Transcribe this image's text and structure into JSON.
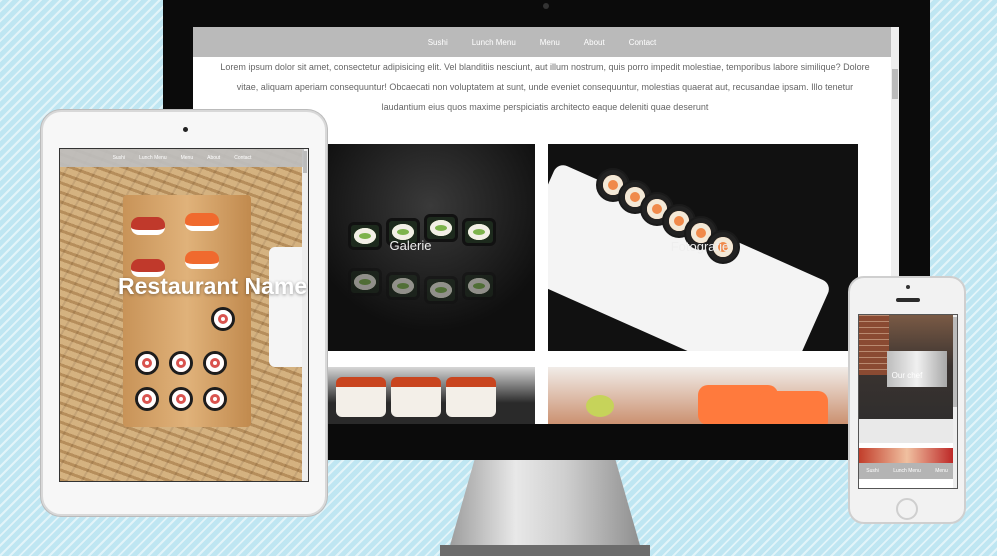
{
  "desktop": {
    "nav": [
      "Sushi",
      "Lunch Menu",
      "Menu",
      "About",
      "Contact"
    ],
    "intro_text": "Lorem ipsum dolor sit amet, consectetur adipisicing elit. Vel blanditiis nesciunt, aut illum nostrum, quis porro impedit molestiae, temporibus labore similique? Dolore vitae, aliquam aperiam consequuntur! Obcaecati non voluptatem at sunt, unde eveniet consequuntur, molestias quaerat aut, recusandae ipsam. Illo tenetur laudantium eius quos maxime perspiciatis architecto eaque deleniti quae deserunt",
    "gallery": [
      {
        "caption": "Galerie"
      },
      {
        "caption": "Fotografie"
      }
    ]
  },
  "tablet": {
    "nav": [
      "Sushi",
      "Lunch Menu",
      "Menu",
      "About",
      "Contact"
    ],
    "hero_title": "Restaurant Name"
  },
  "phone": {
    "caption": "Our chef",
    "nav": [
      "Sushi",
      "Lunch Menu",
      "Menu"
    ]
  }
}
